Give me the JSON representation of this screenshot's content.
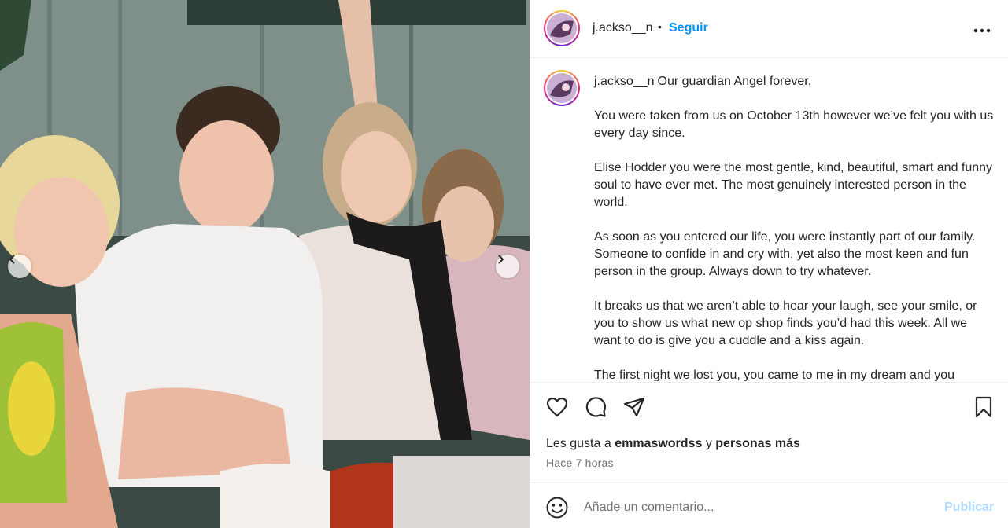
{
  "post": {
    "username": "j.ackso__n",
    "follow_label": "Seguir",
    "separator": "•",
    "caption": {
      "username": "j.ackso__n",
      "first_line": "Our guardian Angel forever.",
      "paragraphs": [
        "You were taken from us on October 13th however we’ve felt you with us every day since.",
        "Elise Hodder you were the most gentle, kind, beautiful, smart and funny soul to have ever met. The most genuinely interested person in the world.",
        "As soon as you entered our life, you were instantly part of our family. Someone to confide in and cry with, yet also the most keen and fun person in the group. Always down to try whatever.",
        "It breaks us that we aren’t able to hear your laugh, see your smile, or you to show us what new op shop finds you’d had this week. All we want to do is give you a cuddle and a kiss again.",
        "The first night we lost you, you came to me in my dream and you"
      ]
    },
    "likes": {
      "prefix": "Les gusta a",
      "user": "emmaswordss",
      "middle": "y",
      "others": "personas más"
    },
    "timestamp": "Hace 7 horas"
  },
  "comment": {
    "placeholder": "Añade un comentario...",
    "publish_label": "Publicar"
  },
  "icons": {
    "options": "more-horizontal-icon",
    "like": "heart-icon",
    "comment": "comment-icon",
    "share": "send-icon",
    "save": "bookmark-icon",
    "emoji": "emoji-icon",
    "prev": "chevron-left-icon",
    "next": "chevron-right-icon"
  },
  "colors": {
    "link_blue": "#0095f6",
    "publish_disabled": "#b3dbff",
    "secondary_text": "#737373",
    "border": "#efefef"
  }
}
